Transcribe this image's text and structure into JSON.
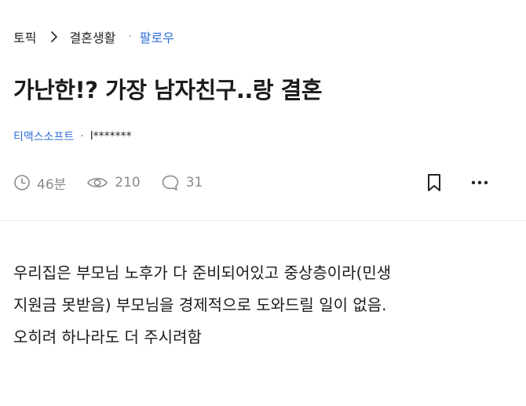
{
  "breadcrumb": {
    "root": "토픽",
    "topic": "결혼생활",
    "separator": "·",
    "follow": "팔로우"
  },
  "post": {
    "title": "가난한!? 가장 남자친구..랑 결혼",
    "company": "티맥스소프트",
    "meta_separator": "·",
    "author": "l*******",
    "time": "46분",
    "views": "210",
    "comments": "31",
    "body_lines": [
      "우리집은 부모님 노후가 다 준비되어있고 중상층이라(민생",
      "지원금 못받음) 부모님을 경제적으로 도와드릴 일이 없음.",
      "오히려 하나라도 더 주시려함"
    ]
  },
  "icons": {
    "breadcrumb_chevron": "chevron-right-icon",
    "time": "clock-icon",
    "views": "eye-icon",
    "comments": "comment-bubble-icon",
    "bookmark": "bookmark-icon",
    "more": "more-horizontal-icon"
  },
  "colors": {
    "accent_blue": "#2f6fd8",
    "muted_gray": "#8a8a8a",
    "text": "#1b1b1b"
  }
}
